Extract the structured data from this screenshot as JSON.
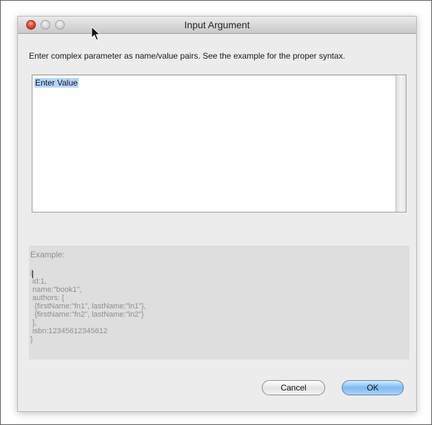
{
  "window": {
    "title": "Input Argument"
  },
  "dialog": {
    "instructions": "Enter complex parameter as name/value pairs. See the example for the proper syntax.",
    "value_text": "Enter Value",
    "example_label": "Example:",
    "example_code": "{\n id:1,\n name:\"book1\",\n authors: [\n  {firstName:\"fn1\", lastName:\"ln1\"},\n  {firstName:\"fn2\", lastName:\"ln2\"}\n ],\n isbn:12345612345612\n}"
  },
  "buttons": {
    "cancel_label": "Cancel",
    "ok_label": "OK"
  },
  "icons": {
    "close": "close-icon",
    "minimize": "minimize-icon",
    "maximize": "maximize-icon",
    "cursor": "mouse-cursor-icon"
  },
  "colors": {
    "close_button": "#e2473a",
    "default_button": "#7fbaf0",
    "selection": "#b5d5ff"
  }
}
